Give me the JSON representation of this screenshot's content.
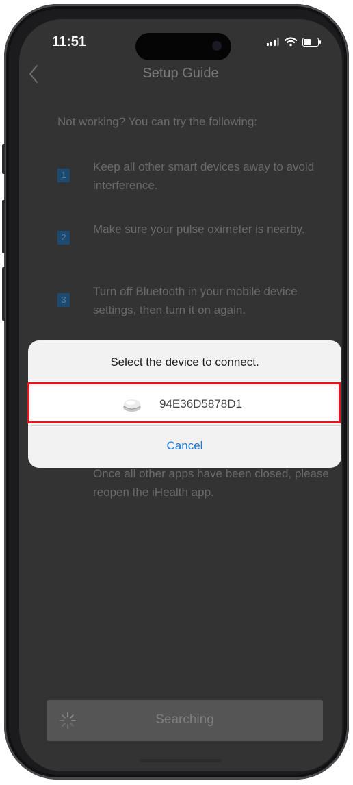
{
  "status_bar": {
    "time": "11:51",
    "icons": [
      "signal-icon",
      "wifi-icon",
      "battery-icon"
    ]
  },
  "nav": {
    "title": "Setup Guide",
    "back_icon": "chevron-left-icon"
  },
  "guide": {
    "intro": "Not working? You can try the following:",
    "steps": [
      {
        "number": "1",
        "text": "Keep all other smart devices away to avoid interference."
      },
      {
        "number": "2",
        "text": "Make sure your pulse oximeter is nearby."
      },
      {
        "number": "3",
        "text": "Turn off Bluetooth in your mobile device settings, then turn it on again."
      },
      {
        "number": "",
        "text": "Once all other apps have been closed, please reopen the iHealth app."
      }
    ]
  },
  "dialog": {
    "title": "Select the device to connect.",
    "device": {
      "id": "94E36D5878D1",
      "icon": "pulse-oximeter-icon"
    },
    "cancel_label": "Cancel"
  },
  "footer": {
    "search_label": "Searching",
    "spinner_icon": "spinner-icon"
  },
  "colors": {
    "screen_bg": "#333333",
    "link_blue": "#1b7ad6",
    "highlight_red": "#e2141c",
    "step_badge": "#1d4a70"
  }
}
